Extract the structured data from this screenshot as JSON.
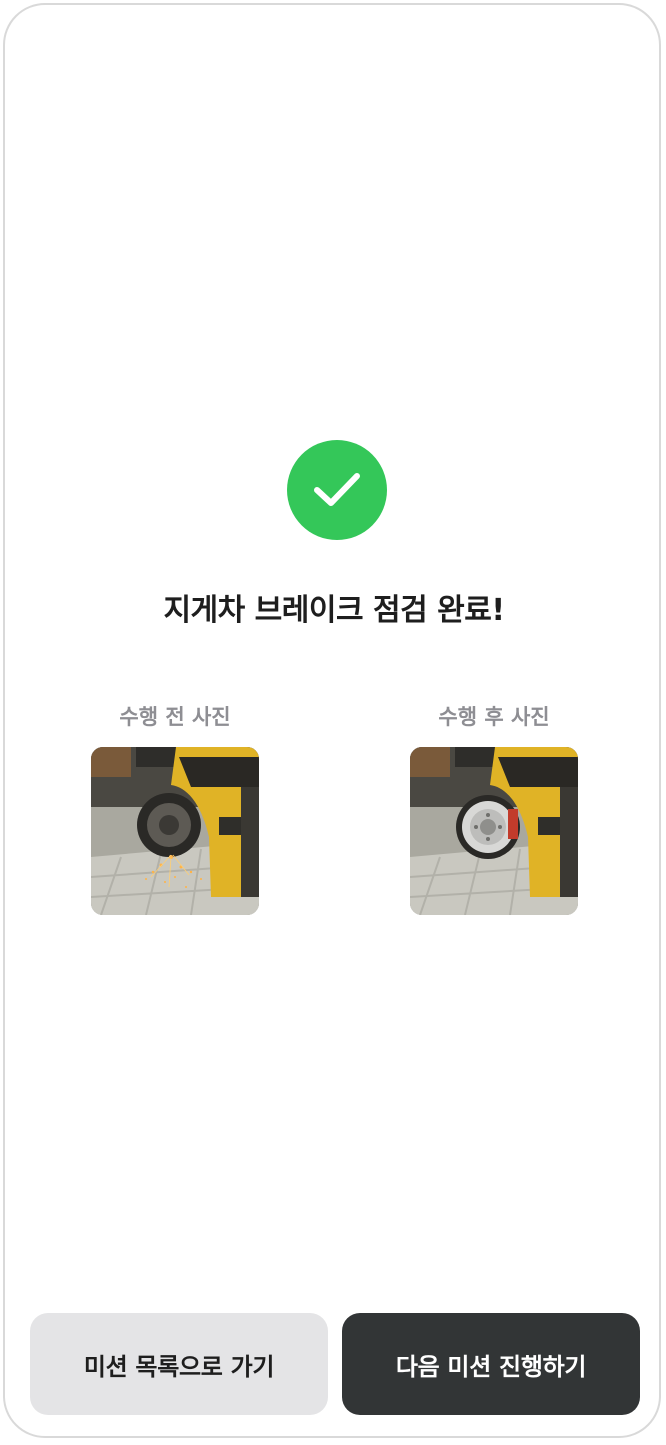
{
  "complete": {
    "icon": "check-icon",
    "accent_color": "#34c759",
    "title": "지게차 브레이크 점검 완료!"
  },
  "photos": {
    "before": {
      "label": "수행 전 사진",
      "image": "forklift-brake-before-photo"
    },
    "after": {
      "label": "수행 후 사진",
      "image": "forklift-brake-after-photo"
    }
  },
  "actions": {
    "back_to_list_label": "미션 목록으로 가기",
    "next_mission_label": "다음 미션 진행하기"
  }
}
